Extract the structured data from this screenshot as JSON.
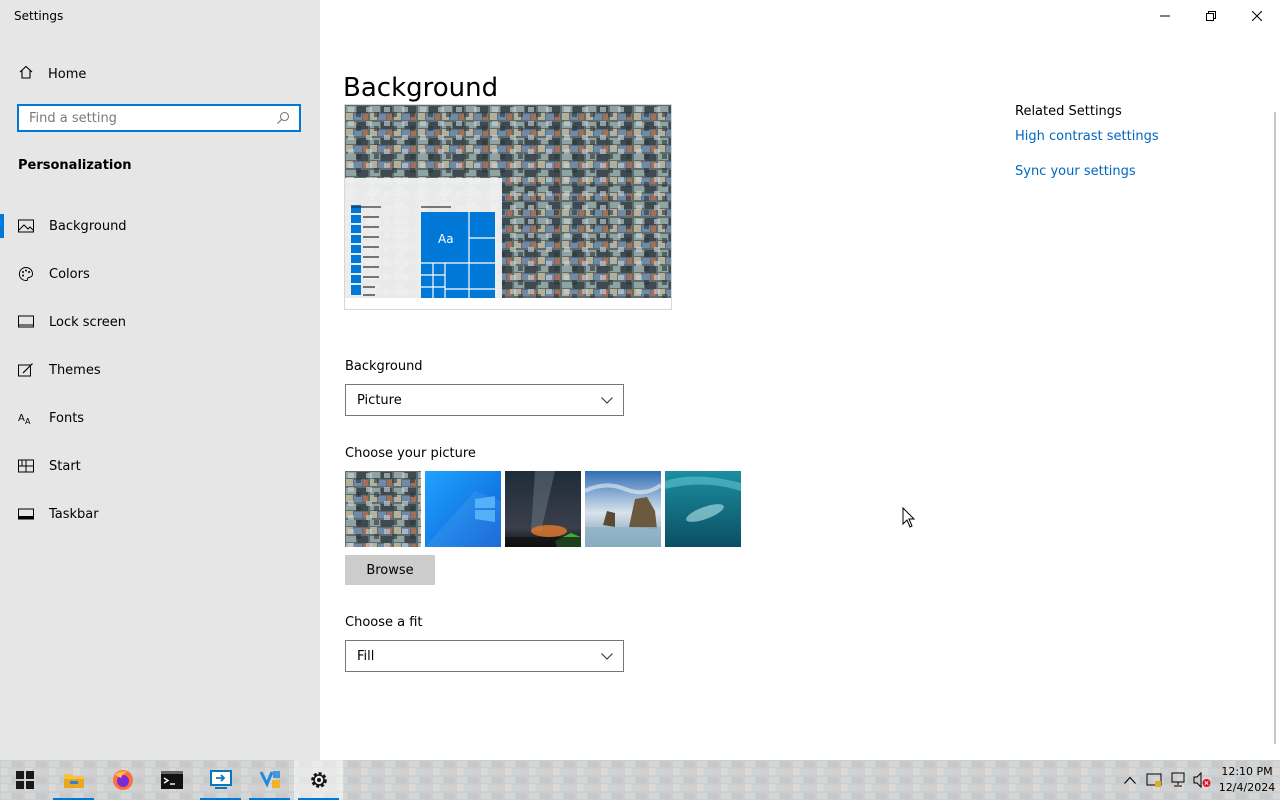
{
  "window": {
    "title": "Settings"
  },
  "sidebar": {
    "home_label": "Home",
    "search_placeholder": "Find a setting",
    "section_label": "Personalization",
    "items": [
      {
        "label": "Background",
        "icon": "picture-icon",
        "active": true
      },
      {
        "label": "Colors",
        "icon": "palette-icon",
        "active": false
      },
      {
        "label": "Lock screen",
        "icon": "lock-screen-icon",
        "active": false
      },
      {
        "label": "Themes",
        "icon": "themes-icon",
        "active": false
      },
      {
        "label": "Fonts",
        "icon": "fonts-icon",
        "active": false
      },
      {
        "label": "Start",
        "icon": "start-icon",
        "active": false
      },
      {
        "label": "Taskbar",
        "icon": "taskbar-icon",
        "active": false
      }
    ]
  },
  "main": {
    "title": "Background",
    "preview": {
      "tile_text": "Aa"
    },
    "background": {
      "label": "Background",
      "value": "Picture"
    },
    "choose_picture": {
      "label": "Choose your picture",
      "browse_label": "Browse"
    },
    "fit": {
      "label": "Choose a fit",
      "value": "Fill"
    }
  },
  "related": {
    "title": "Related Settings",
    "links": [
      "High contrast settings",
      "Sync your settings"
    ]
  },
  "taskbar": {
    "apps": [
      "start-icon",
      "file-explorer-icon",
      "firefox-icon",
      "terminal-icon",
      "remote-desktop-icon",
      "visual-studio-icon",
      "settings-icon"
    ],
    "clock": {
      "time": "12:10 PM",
      "date": "12/4/2024"
    }
  },
  "colors": {
    "accent": "#0078d7",
    "link": "#0067c0",
    "sidebar": "#e6e6e6"
  }
}
